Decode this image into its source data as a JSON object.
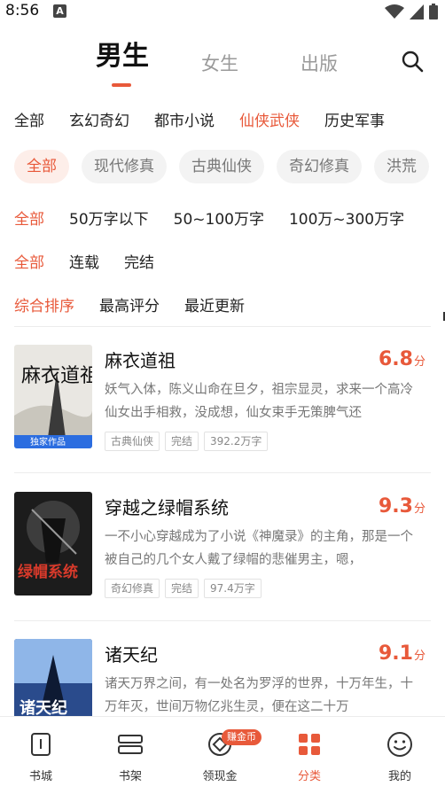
{
  "status_bar": {
    "time": "8:56",
    "app_icon_letter": "A"
  },
  "top_tabs": [
    {
      "label": "男生",
      "active": true
    },
    {
      "label": "女生",
      "active": false
    },
    {
      "label": "出版",
      "active": false
    }
  ],
  "category_row": [
    "全部",
    "玄幻奇幻",
    "都市小说",
    "仙侠武侠",
    "历史军事"
  ],
  "subcategory_chips": [
    "全部",
    "现代修真",
    "古典仙侠",
    "奇幻修真",
    "洪荒"
  ],
  "word_count_row": [
    "全部",
    "50万字以下",
    "50~100万字",
    "100万~300万字"
  ],
  "status_row": [
    "全部",
    "连载",
    "完结"
  ],
  "sort_row": [
    "综合排序",
    "最高评分",
    "最近更新"
  ],
  "books": [
    {
      "title": "麻衣道祖",
      "score": "6.8",
      "score_unit": "分",
      "description": "妖气入体，陈义山命在旦夕，祖宗显灵，求来一个高冷仙女出手相救，没成想，仙女束手无策脾气还",
      "tags": [
        "古典仙侠",
        "完结",
        "392.2万字"
      ],
      "cover_text": "麻衣道祖",
      "cover_badge": "独家作品"
    },
    {
      "title": "穿越之绿帽系统",
      "score": "9.3",
      "score_unit": "分",
      "description": "一不小心穿越成为了小说《神魔录》的主角，那是一个被自己的几个女人戴了绿帽的悲催男主，嗯，",
      "tags": [
        "奇幻修真",
        "完结",
        "97.4万字"
      ],
      "cover_text": "绿帽系统"
    },
    {
      "title": "诸天纪",
      "score": "9.1",
      "score_unit": "分",
      "description": "诸天万界之间，有一处名为罗浮的世界，十万年生，十万年灭，世间万物亿兆生灵，便在这二十万",
      "cover_text": "诸天纪"
    }
  ],
  "bottom_nav": [
    {
      "label": "书城",
      "icon": "book-city-icon",
      "active": false
    },
    {
      "label": "书架",
      "icon": "bookshelf-icon",
      "active": false
    },
    {
      "label": "领现金",
      "icon": "cash-icon",
      "active": false,
      "badge": "赚金币"
    },
    {
      "label": "分类",
      "icon": "category-icon",
      "active": true
    },
    {
      "label": "我的",
      "icon": "profile-icon",
      "active": false
    }
  ],
  "colors": {
    "accent": "#e8593a",
    "chip_bg": "#f3f3f3",
    "muted_text": "#777777"
  }
}
